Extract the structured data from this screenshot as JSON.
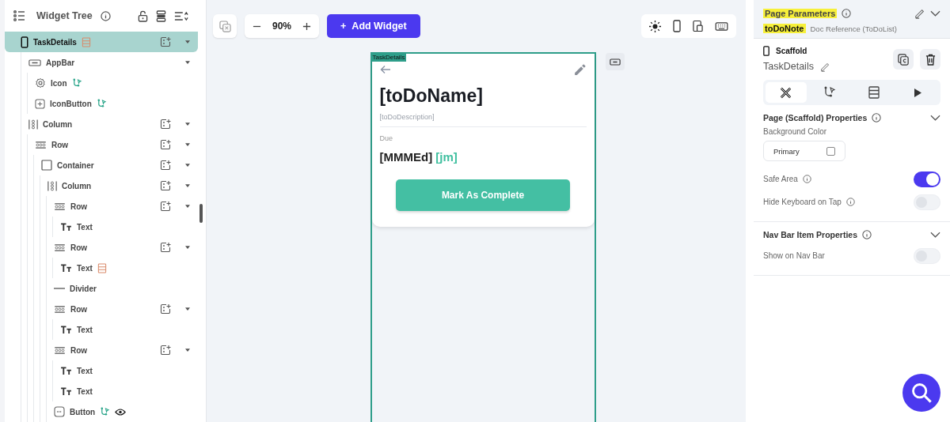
{
  "widget_tree": {
    "title": "Widget Tree",
    "items": [
      {
        "name": "TaskDetails",
        "kind": "phone",
        "selected": true,
        "add": true,
        "caret": true,
        "badges": [
          {
            "kind": "backend"
          }
        ],
        "children": [
          {
            "name": "AppBar",
            "kind": "appbar",
            "selected": false,
            "add": false,
            "caret": true,
            "children": [
              {
                "name": "Icon",
                "kind": "gear",
                "selected": false,
                "add": false,
                "caret": false,
                "badges": [
                  {
                    "kind": "action"
                  }
                ]
              },
              {
                "name": "IconButton",
                "kind": "iconbutton",
                "selected": false,
                "add": false,
                "caret": false,
                "badges": [
                  {
                    "kind": "action"
                  }
                ]
              }
            ]
          },
          {
            "name": "Column",
            "kind": "column",
            "selected": false,
            "add": true,
            "caret": true,
            "children": [
              {
                "name": "Row",
                "kind": "row",
                "selected": false,
                "add": true,
                "caret": true,
                "children": [
                  {
                    "name": "Container",
                    "kind": "container",
                    "selected": false,
                    "add": true,
                    "caret": true,
                    "children": [
                      {
                        "name": "Column",
                        "kind": "column",
                        "selected": false,
                        "add": true,
                        "caret": true,
                        "children": [
                          {
                            "name": "Row",
                            "kind": "row",
                            "selected": false,
                            "add": true,
                            "caret": true,
                            "children": [
                              {
                                "name": "Text",
                                "kind": "text",
                                "selected": false,
                                "add": false,
                                "caret": false
                              }
                            ]
                          },
                          {
                            "name": "Row",
                            "kind": "row",
                            "selected": false,
                            "add": true,
                            "caret": true,
                            "children": [
                              {
                                "name": "Text",
                                "kind": "text",
                                "selected": false,
                                "add": false,
                                "caret": false,
                                "badges": [
                                  {
                                    "kind": "backend"
                                  }
                                ]
                              }
                            ]
                          },
                          {
                            "name": "Divider",
                            "kind": "divider",
                            "selected": false,
                            "add": false,
                            "caret": false
                          },
                          {
                            "name": "Row",
                            "kind": "row",
                            "selected": false,
                            "add": true,
                            "caret": true,
                            "children": [
                              {
                                "name": "Text",
                                "kind": "text",
                                "selected": false,
                                "add": false,
                                "caret": false
                              }
                            ]
                          },
                          {
                            "name": "Row",
                            "kind": "row",
                            "selected": false,
                            "add": true,
                            "caret": true,
                            "children": [
                              {
                                "name": "Text",
                                "kind": "text",
                                "selected": false,
                                "add": false,
                                "caret": false
                              },
                              {
                                "name": "Text",
                                "kind": "text",
                                "selected": false,
                                "add": false,
                                "caret": false
                              }
                            ]
                          },
                          {
                            "name": "Button",
                            "kind": "button",
                            "selected": false,
                            "add": false,
                            "caret": false,
                            "badges": [
                              {
                                "kind": "action"
                              },
                              {
                                "kind": "visibility"
                              }
                            ]
                          }
                        ]
                      }
                    ]
                  }
                ]
              }
            ]
          }
        ]
      }
    ]
  },
  "toolbar": {
    "zoom": "90%",
    "add_widget": "Add Widget",
    "plus": "+"
  },
  "device_tools": [
    {
      "kind": "sun"
    },
    {
      "kind": "phone"
    },
    {
      "kind": "tablet"
    },
    {
      "kind": "keyboard"
    }
  ],
  "phone": {
    "page_tag": "TaskDetails",
    "title": "[toDoName]",
    "description": "[toDoDescription]",
    "due_label": "Due",
    "date": "[MMMEd]",
    "time": "[jm]",
    "button": "Mark As Complete"
  },
  "properties": {
    "page_parameters": {
      "title": "Page Parameters",
      "highlighted": true,
      "param_name": "toDoNote",
      "param_highlighted": true,
      "param_type": "Doc Reference (ToDoList)"
    },
    "widget_type": "Scaffold",
    "widget_name": "TaskDetails",
    "tabs": [
      {
        "kind": "design",
        "selected": true
      },
      {
        "kind": "actions",
        "selected": false
      },
      {
        "kind": "backend",
        "selected": false
      },
      {
        "kind": "run",
        "selected": false
      }
    ],
    "sections": [
      {
        "title": "Page (Scaffold) Properties",
        "expanded": true,
        "rows": [
          {
            "kind": "color",
            "label": "Background Color",
            "value": "Primary"
          },
          {
            "kind": "toggle",
            "label": "Safe Area",
            "info": true,
            "on": true
          },
          {
            "kind": "toggle",
            "label": "Hide Keyboard on Tap",
            "info": true,
            "on": false
          }
        ]
      },
      {
        "title": "Nav Bar Item Properties",
        "expanded": true,
        "rows": [
          {
            "kind": "toggle",
            "label": "Show on Nav Bar",
            "info": false,
            "on": false
          }
        ]
      }
    ]
  }
}
